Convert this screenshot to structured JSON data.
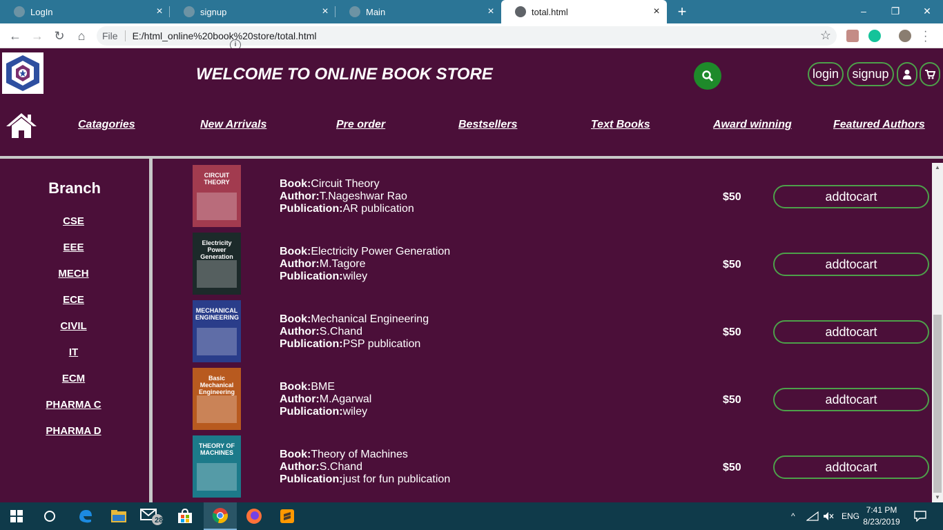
{
  "browser": {
    "tabs": [
      {
        "label": "LogIn",
        "close": "×"
      },
      {
        "label": "signup",
        "close": "×"
      },
      {
        "label": "Main",
        "close": "×"
      },
      {
        "label": "total.html",
        "close": "×"
      }
    ],
    "new_tab": "+",
    "window_controls": {
      "minimize": "–",
      "maximize": "❐",
      "close": "✕"
    },
    "address": {
      "scheme_label": "File",
      "url": "E:/html_online%20book%20store/total.html"
    }
  },
  "header": {
    "title": "WELCOME TO ONLINE BOOK STORE",
    "login_label": "login",
    "signup_label": "signup"
  },
  "nav": {
    "items": [
      "Catagories",
      "New Arrivals",
      "Pre order",
      "Bestsellers",
      "Text Books",
      "Award winning",
      "Featured Authors"
    ]
  },
  "sidebar": {
    "title": "Branch",
    "items": [
      "CSE",
      "EEE",
      "MECH",
      "ECE",
      "CIVIL",
      "IT",
      "ECM",
      "PHARMA C",
      "PHARMA D"
    ]
  },
  "labels": {
    "book": "Book:",
    "author": "Author:",
    "publication": "Publication:"
  },
  "books": [
    {
      "title": "Circuit Theory",
      "author": "T.Nageshwar Rao",
      "publication": "AR publication",
      "price": "$50",
      "button": "addtocart",
      "cover_text": "CIRCUIT THEORY",
      "cover_color": "#a23b4f"
    },
    {
      "title": "Electricity Power Generation",
      "author": "M.Tagore",
      "publication": "wiley",
      "price": "$50",
      "button": "addtocart",
      "cover_text": "Electricity Power Generation",
      "cover_color": "#1c2a2a"
    },
    {
      "title": "Mechanical Engineering",
      "author": "S.Chand",
      "publication": "PSP publication",
      "price": "$50",
      "button": "addtocart",
      "cover_text": "MECHANICAL ENGINEERING",
      "cover_color": "#2a3d8a"
    },
    {
      "title": "BME",
      "author": "M.Agarwal",
      "publication": "wiley",
      "price": "$50",
      "button": "addtocart",
      "cover_text": "Basic Mechanical Engineering",
      "cover_color": "#b85a1f"
    },
    {
      "title": "Theory of Machines",
      "author": "S.Chand",
      "publication": "just for fun publication",
      "price": "$50",
      "button": "addtocart",
      "cover_text": "THEORY OF MACHINES",
      "cover_color": "#1c7a8a"
    }
  ],
  "taskbar": {
    "mail_badge": "28",
    "language": "ENG",
    "time": "7:41 PM",
    "date": "8/23/2019"
  },
  "colors": {
    "page_bg": "#4b0f39",
    "accent_green": "#4da04a",
    "tabbar": "#2b7596",
    "taskbar": "#0f3a4a"
  }
}
